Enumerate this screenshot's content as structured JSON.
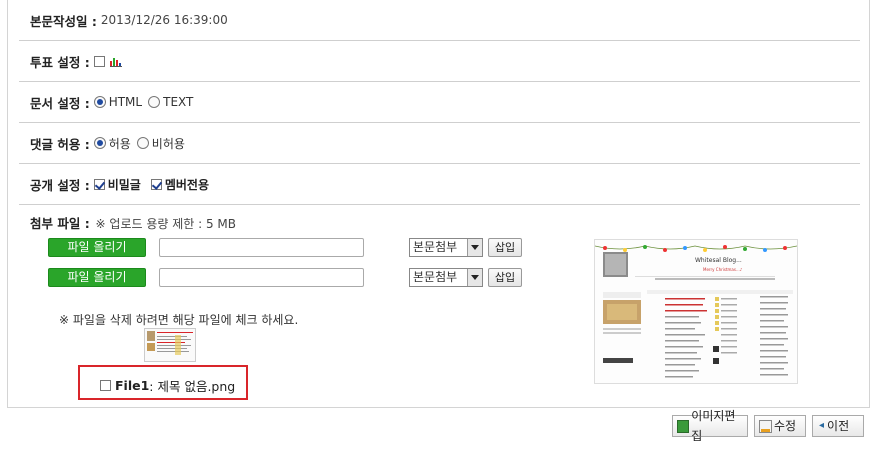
{
  "created": {
    "label": "본문작성일 :",
    "value": "2013/12/26 16:39:00"
  },
  "vote": {
    "label": "투표 설정 :"
  },
  "doc": {
    "label": "문서 설정 :",
    "opt1": "HTML",
    "opt2": "TEXT"
  },
  "comment": {
    "label": "댓글 허용 :",
    "opt1": "허용",
    "opt2": "비허용"
  },
  "public": {
    "label": "공개 설정 :",
    "opt1": "비밀글",
    "opt2": "멤버전용"
  },
  "attach": {
    "label": "첨부 파일 :",
    "limit": "※ 업로드 용량 제한 : 5 MB",
    "upload_label": "파일 올리기",
    "select_value": "본문첨부",
    "insert_label": "삽입",
    "notice": "※ 파일을 삭제 하려면 해당 파일에 체크 하세요.",
    "file_key": "File1",
    "file_name": ": 제목 없음.png"
  },
  "preview": {
    "blog_title": "Whitesal Blog...",
    "blog_sub": "Merry Christmas...♪"
  },
  "buttons": {
    "image_edit": "이미지편집",
    "edit": "수정",
    "prev": "이전"
  },
  "colors": {
    "green": "#2aa52a",
    "highlight": "#d9252a",
    "radio": "#1f4aa0"
  }
}
